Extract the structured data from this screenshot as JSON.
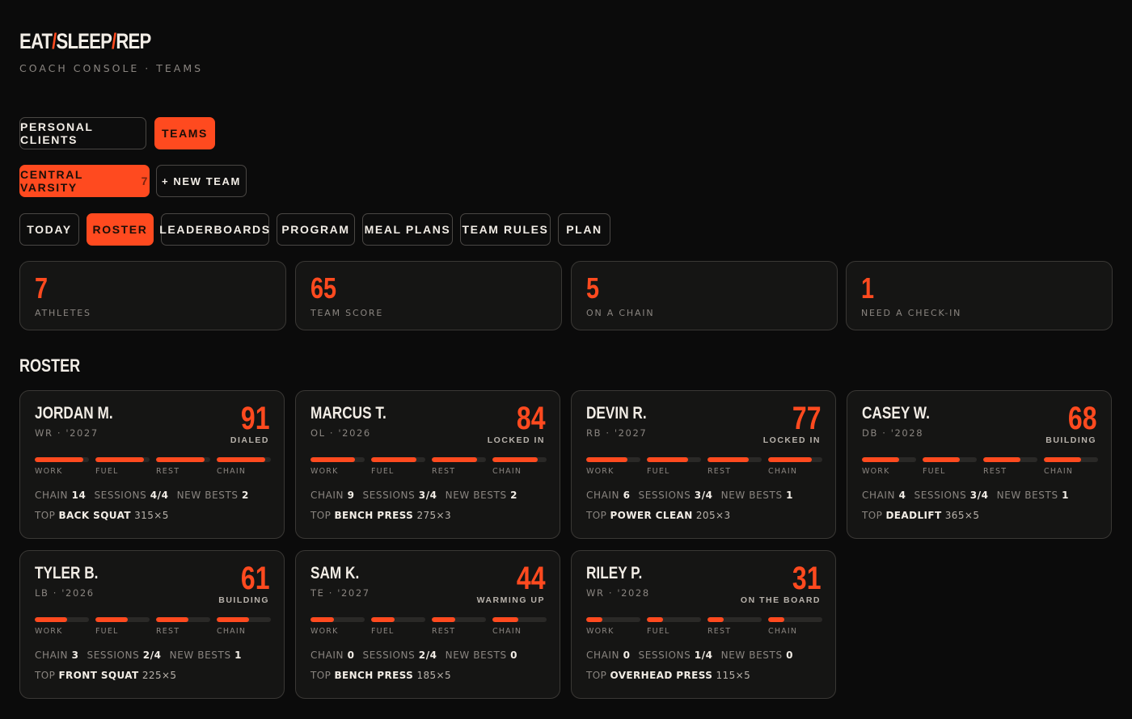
{
  "brand": {
    "part1": "EAT",
    "part2": "SLEEP",
    "part3": "REP",
    "separator": "/"
  },
  "subtitle": "COACH CONSOLE · TEAMS",
  "mode_tabs": [
    {
      "label": "PERSONAL CLIENTS",
      "active": false
    },
    {
      "label": "TEAMS",
      "active": true
    }
  ],
  "team": {
    "name": "CENTRAL VARSITY",
    "count": "7",
    "new_team_label": "+ NEW TEAM"
  },
  "section_tabs": [
    {
      "label": "TODAY",
      "active": false
    },
    {
      "label": "ROSTER",
      "active": true
    },
    {
      "label": "LEADERBOARDS",
      "active": false
    },
    {
      "label": "PROGRAM",
      "active": false
    },
    {
      "label": "MEAL PLANS",
      "active": false
    },
    {
      "label": "TEAM RULES",
      "active": false
    },
    {
      "label": "PLAN",
      "active": false
    }
  ],
  "stats": [
    {
      "value": "7",
      "label": "ATHLETES"
    },
    {
      "value": "65",
      "label": "TEAM SCORE"
    },
    {
      "value": "5",
      "label": "ON A CHAIN"
    },
    {
      "value": "1",
      "label": "NEED A CHECK-IN"
    }
  ],
  "roster_title": "ROSTER",
  "labels": {
    "work": "WORK",
    "fuel": "FUEL",
    "rest": "REST",
    "chain": "CHAIN",
    "chain_stat": "CHAIN",
    "sessions": "SESSIONS",
    "new_bests": "NEW BESTS",
    "top": "TOP"
  },
  "athletes": [
    {
      "name": "JORDAN M.",
      "meta": "WR · '2027",
      "score": "91",
      "status": "DIALED",
      "levels": {
        "work": 0.9,
        "fuel": 0.9,
        "rest": 0.9,
        "chain": 0.9
      },
      "chain": "14",
      "sessions": "4/4",
      "new_bests": "2",
      "top_lift": "BACK SQUAT",
      "top_set": "315×5"
    },
    {
      "name": "MARCUS T.",
      "meta": "OL · '2026",
      "score": "84",
      "status": "LOCKED IN",
      "levels": {
        "work": 0.82,
        "fuel": 0.84,
        "rest": 0.84,
        "chain": 0.84
      },
      "chain": "9",
      "sessions": "3/4",
      "new_bests": "2",
      "top_lift": "BENCH PRESS",
      "top_set": "275×3"
    },
    {
      "name": "DEVIN R.",
      "meta": "RB · '2027",
      "score": "77",
      "status": "LOCKED IN",
      "levels": {
        "work": 0.76,
        "fuel": 0.76,
        "rest": 0.76,
        "chain": 0.8
      },
      "chain": "6",
      "sessions": "3/4",
      "new_bests": "1",
      "top_lift": "POWER CLEAN",
      "top_set": "205×3"
    },
    {
      "name": "CASEY W.",
      "meta": "DB · '2028",
      "score": "68",
      "status": "BUILDING",
      "levels": {
        "work": 0.68,
        "fuel": 0.68,
        "rest": 0.68,
        "chain": 0.68
      },
      "chain": "4",
      "sessions": "3/4",
      "new_bests": "1",
      "top_lift": "DEADLIFT",
      "top_set": "365×5"
    },
    {
      "name": "TYLER B.",
      "meta": "LB · '2026",
      "score": "61",
      "status": "BUILDING",
      "levels": {
        "work": 0.6,
        "fuel": 0.6,
        "rest": 0.6,
        "chain": 0.6
      },
      "chain": "3",
      "sessions": "2/4",
      "new_bests": "1",
      "top_lift": "FRONT SQUAT",
      "top_set": "225×5"
    },
    {
      "name": "SAM K.",
      "meta": "TE · '2027",
      "score": "44",
      "status": "WARMING UP",
      "levels": {
        "work": 0.44,
        "fuel": 0.44,
        "rest": 0.44,
        "chain": 0.48
      },
      "chain": "0",
      "sessions": "2/4",
      "new_bests": "0",
      "top_lift": "BENCH PRESS",
      "top_set": "185×5"
    },
    {
      "name": "RILEY P.",
      "meta": "WR · '2028",
      "score": "31",
      "status": "ON THE BOARD",
      "levels": {
        "work": 0.3,
        "fuel": 0.3,
        "rest": 0.3,
        "chain": 0.3
      },
      "chain": "0",
      "sessions": "1/4",
      "new_bests": "0",
      "top_lift": "OVERHEAD PRESS",
      "top_set": "115×5"
    }
  ],
  "colors": {
    "accent": "#ff4a1f",
    "background": "#0b0b0b",
    "card": "#151514"
  }
}
